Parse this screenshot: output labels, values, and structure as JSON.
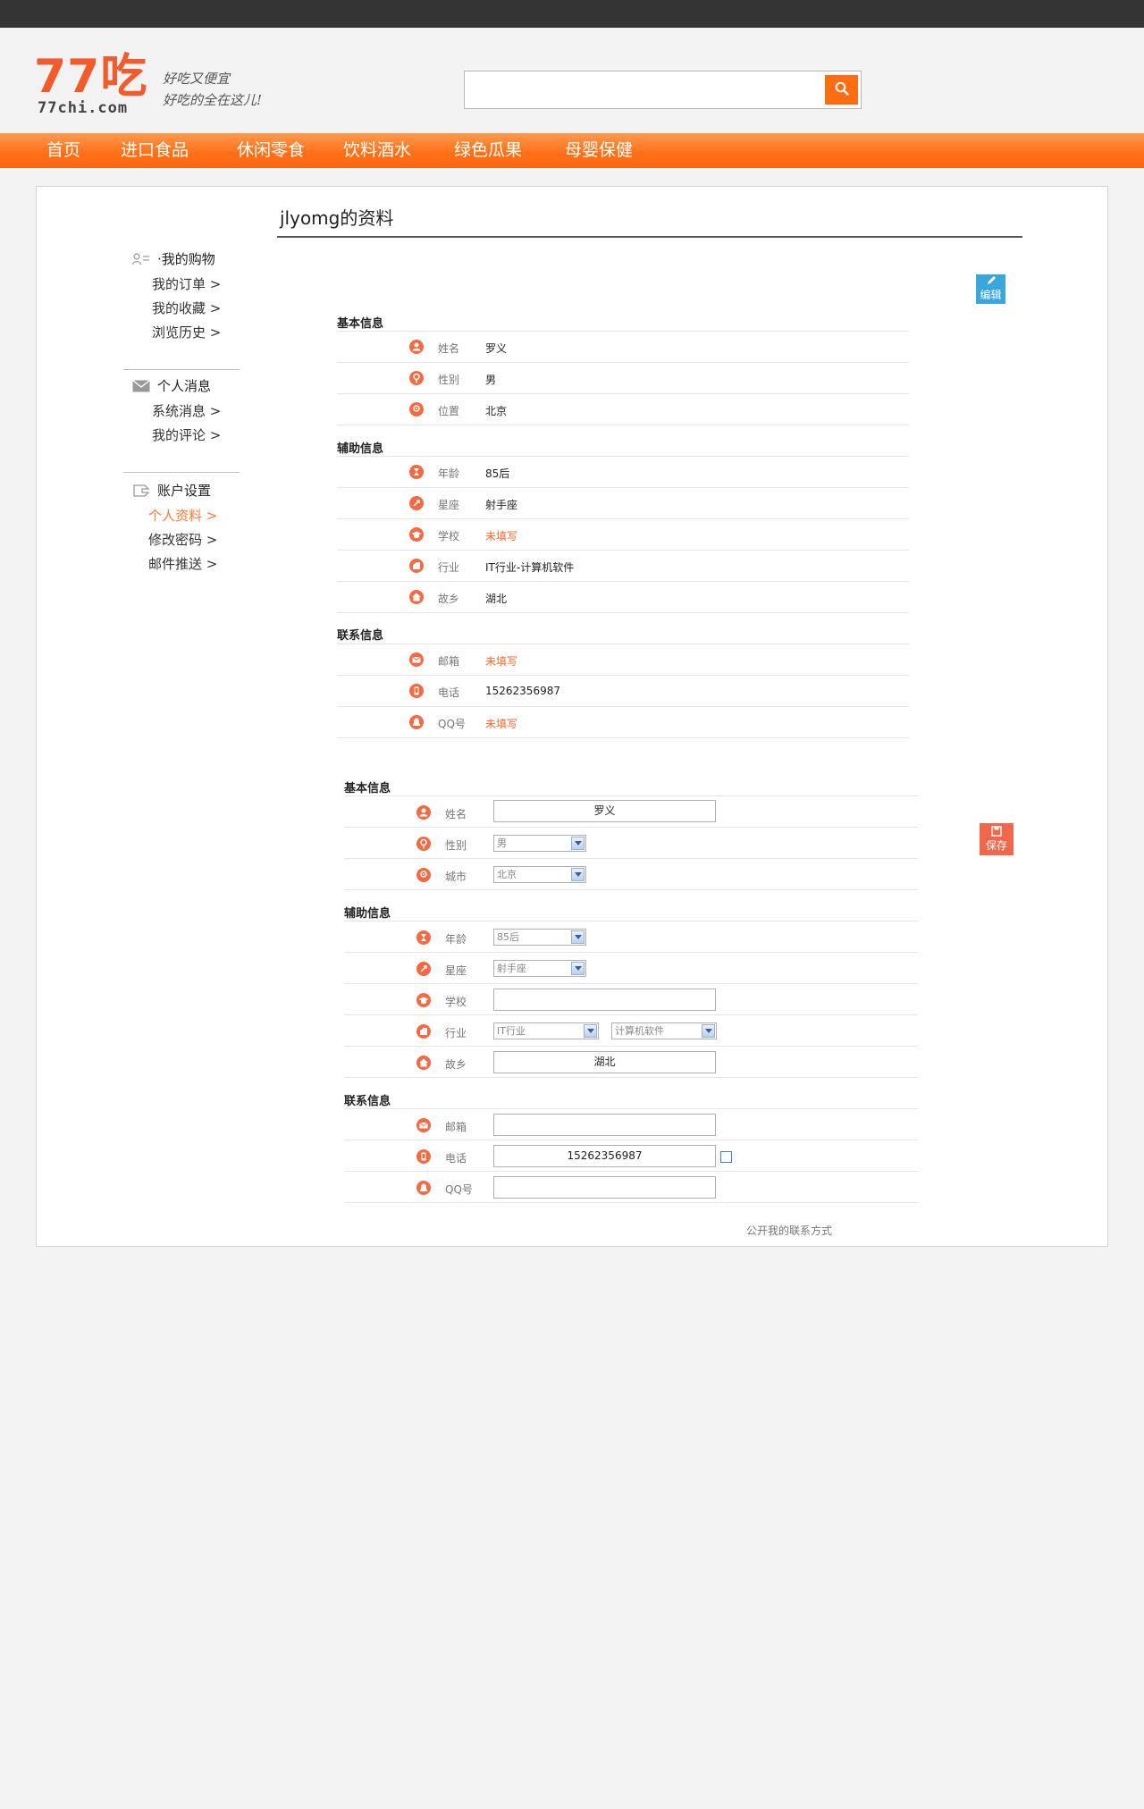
{
  "header": {
    "logo_text": "77吃",
    "logo_domain": "77chi.com",
    "slogan_line1": "好吃又便宜",
    "slogan_line2": "好吃的全在这儿!",
    "search_placeholder": ""
  },
  "nav": [
    "首页",
    "进口食品",
    "休闲零食",
    "饮料酒水",
    "绿色瓜果",
    "母婴保健"
  ],
  "page": {
    "title": "jlyomg的资料"
  },
  "sidebar": {
    "groups": [
      {
        "title": "·我的购物",
        "items": [
          "我的订单 >",
          "我的收藏 >",
          "浏览历史 >"
        ]
      },
      {
        "title": "个人消息",
        "items": [
          "系统消息 >",
          "我的评论 >"
        ]
      },
      {
        "title": "账户设置",
        "items": [
          "个人资料 >",
          "修改密码 >",
          "邮件推送 >"
        ]
      }
    ],
    "active_item": "个人资料 >"
  },
  "view": {
    "edit_label": "编辑",
    "basic": {
      "title": "基本信息",
      "rows": [
        {
          "label": "姓名",
          "value": "罗义"
        },
        {
          "label": "性别",
          "value": "男"
        },
        {
          "label": "位置",
          "value": "北京"
        }
      ]
    },
    "aux": {
      "title": "辅助信息",
      "rows": [
        {
          "label": "年龄",
          "value": "85后"
        },
        {
          "label": "星座",
          "value": "射手座"
        },
        {
          "label": "学校",
          "value": "未填写"
        },
        {
          "label": "行业",
          "value": "IT行业-计算机软件"
        },
        {
          "label": "故乡",
          "value": "湖北"
        }
      ]
    },
    "contact": {
      "title": "联系信息",
      "rows": [
        {
          "label": "邮箱",
          "value": "未填写"
        },
        {
          "label": "电话",
          "value": "15262356987"
        },
        {
          "label": "QQ号",
          "value": "未填写"
        }
      ]
    }
  },
  "form": {
    "save_label": "保存",
    "basic": {
      "title": "基本信息",
      "name_label": "姓名",
      "name_value": "罗义",
      "gender_label": "性别",
      "gender_value": "男",
      "city_label": "城市",
      "city_value": "北京"
    },
    "aux": {
      "title": "辅助信息",
      "age_label": "年龄",
      "age_value": "85后",
      "star_label": "星座",
      "star_value": "射手座",
      "school_label": "学校",
      "school_value": "",
      "industry_label": "行业",
      "industry_value": "IT行业",
      "industry_sub_value": "计算机软件",
      "hometown_label": "故乡",
      "hometown_value": "湖北"
    },
    "contact": {
      "title": "联系信息",
      "email_label": "邮箱",
      "email_value": "",
      "phone_label": "电话",
      "phone_value": "15262356987",
      "qq_label": "QQ号",
      "qq_value": ""
    },
    "public_note": "公开我的联系方式"
  },
  "colors": {
    "brand": "#ff7219",
    "accent_icon": "#f26b45",
    "empty_value": "#ff6a2a",
    "edit_button": "#3ba6dc",
    "save_button": "#f1674c"
  }
}
